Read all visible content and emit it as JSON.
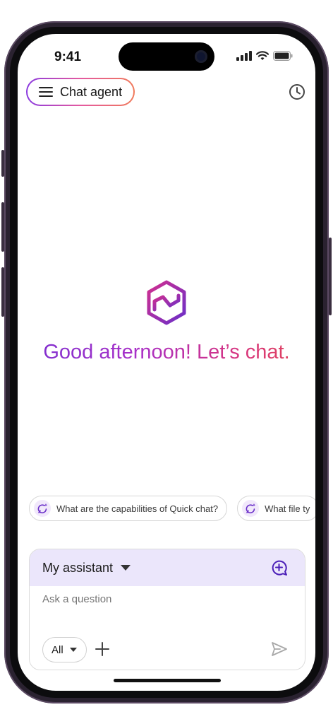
{
  "status_bar": {
    "time": "9:41"
  },
  "header": {
    "agent_label": "Chat agent",
    "menu_icon": "hamburger-menu-icon",
    "history_icon": "clock-history-icon"
  },
  "hero": {
    "logo_icon": "hexagon-brand-logo",
    "greeting": "Good afternoon! Let’s chat."
  },
  "suggestions": [
    {
      "label": "What are the capabilities of Quick chat?",
      "icon": "chat-sparkle-icon"
    },
    {
      "label": "What file ty",
      "icon": "chat-sparkle-icon"
    }
  ],
  "composer": {
    "assistant_label": "My assistant",
    "input_placeholder": "Ask a question",
    "filter_value": "All"
  },
  "colors": {
    "accent_purple": "#5b23c7",
    "composer_header_bg": "#ebe6fb",
    "gradient_start": "#7a2fd0",
    "gradient_end": "#e24a55"
  }
}
